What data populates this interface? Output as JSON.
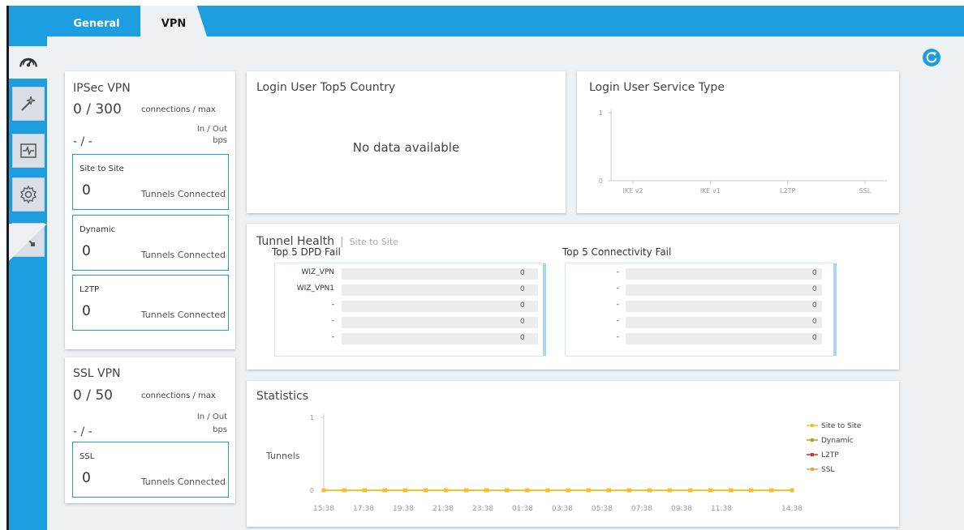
{
  "tabs": [
    {
      "label": "General"
    },
    {
      "label": "VPN"
    }
  ],
  "sidebar": {
    "items": [
      "dashboard-icon",
      "wizard-icon",
      "monitor-icon",
      "settings-icon",
      "maintenance-icon"
    ]
  },
  "ipsec": {
    "title": "IPSec VPN",
    "count": "0 / 300",
    "count_label": "connections / max",
    "inout_label": "In / Out",
    "bps_label": "bps",
    "rate": "- / -",
    "groups": [
      {
        "name": "Site to Site",
        "value": "0",
        "label": "Tunnels Connected"
      },
      {
        "name": "Dynamic",
        "value": "0",
        "label": "Tunnels Connected"
      },
      {
        "name": "L2TP",
        "value": "0",
        "label": "Tunnels Connected"
      }
    ]
  },
  "ssl": {
    "title": "SSL VPN",
    "count": "0 / 50",
    "count_label": "connections / max",
    "inout_label": "In / Out",
    "bps_label": "bps",
    "rate": "- / -",
    "group": {
      "name": "SSL",
      "value": "0",
      "label": "Tunnels Connected"
    }
  },
  "country": {
    "title": "Login User Top5 Country",
    "empty": "No data available"
  },
  "service": {
    "title": "Login User Service Type",
    "chart_data": {
      "type": "bar",
      "title": "Login User Service Type",
      "categories": [
        "IKE v2",
        "IKE v1",
        "L2TP",
        "SSL"
      ],
      "values": [
        0,
        0,
        0,
        0
      ],
      "ylim": [
        0,
        1
      ],
      "yticks": [
        "0",
        "1"
      ]
    }
  },
  "health": {
    "title": "Tunnel Health",
    "separator": "|",
    "subtitle": "Site to Site",
    "dpd_title": "Top 5 DPD Fail",
    "conn_title": "Top 5 Connectivity Fail",
    "dpd_rows": [
      {
        "name": "WIZ_VPN",
        "value": "0"
      },
      {
        "name": "WIZ_VPN1",
        "value": "0"
      },
      {
        "name": "-",
        "value": "0"
      },
      {
        "name": "-",
        "value": "0"
      },
      {
        "name": "-",
        "value": "0"
      }
    ],
    "conn_rows": [
      {
        "name": "-",
        "value": "0"
      },
      {
        "name": "-",
        "value": "0"
      },
      {
        "name": "-",
        "value": "0"
      },
      {
        "name": "-",
        "value": "0"
      },
      {
        "name": "-",
        "value": "0"
      }
    ]
  },
  "statistics": {
    "title": "Statistics",
    "chart_data": {
      "type": "line",
      "ylabel": "Tunnels",
      "ylim": [
        0,
        1
      ],
      "yticks": [
        "0",
        "1"
      ],
      "x": [
        "15:38",
        "16:38",
        "17:38",
        "18:38",
        "19:38",
        "20:38",
        "21:38",
        "22:38",
        "23:38",
        "00:38",
        "01:38",
        "02:38",
        "03:38",
        "04:38",
        "05:38",
        "06:38",
        "07:38",
        "08:38",
        "09:38",
        "10:38",
        "11:38",
        "12:38",
        "13:38",
        "14:38"
      ],
      "xtick_labels": [
        "15:38",
        "17:38",
        "19:38",
        "21:38",
        "23:38",
        "01:38",
        "03:38",
        "05:38",
        "07:38",
        "09:38",
        "11:38",
        "14:38"
      ],
      "series": [
        {
          "name": "Site to Site",
          "color": "#f2c12e",
          "values": [
            0,
            0,
            0,
            0,
            0,
            0,
            0,
            0,
            0,
            0,
            0,
            0,
            0,
            0,
            0,
            0,
            0,
            0,
            0,
            0,
            0,
            0,
            0,
            0
          ]
        },
        {
          "name": "Dynamic",
          "color": "#b5a021",
          "values": [
            0,
            0,
            0,
            0,
            0,
            0,
            0,
            0,
            0,
            0,
            0,
            0,
            0,
            0,
            0,
            0,
            0,
            0,
            0,
            0,
            0,
            0,
            0,
            0
          ]
        },
        {
          "name": "L2TP",
          "color": "#c0392b",
          "values": [
            0,
            0,
            0,
            0,
            0,
            0,
            0,
            0,
            0,
            0,
            0,
            0,
            0,
            0,
            0,
            0,
            0,
            0,
            0,
            0,
            0,
            0,
            0,
            0
          ]
        },
        {
          "name": "SSL",
          "color": "#f0a04b",
          "values": [
            0,
            0,
            0,
            0,
            0,
            0,
            0,
            0,
            0,
            0,
            0,
            0,
            0,
            0,
            0,
            0,
            0,
            0,
            0,
            0,
            0,
            0,
            0,
            0
          ]
        }
      ],
      "legend": "right"
    }
  },
  "colors": {
    "accent": "#1d9ee0",
    "panel_bg": "#ffffff",
    "page_bg": "#eef1f3"
  }
}
